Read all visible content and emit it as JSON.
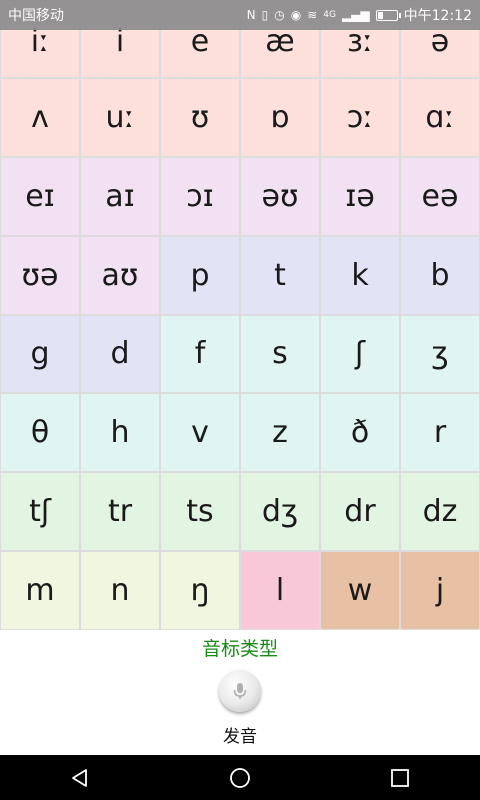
{
  "status_bar": {
    "carrier": "中国移动",
    "time": "中午12:12",
    "network": "4G",
    "battery_level": 0.3
  },
  "phonetic_grid": {
    "rows": [
      [
        {
          "symbol": "iː",
          "color": "#fde0dc"
        },
        {
          "symbol": "i",
          "color": "#fde0dc"
        },
        {
          "symbol": "e",
          "color": "#fde0dc"
        },
        {
          "symbol": "æ",
          "color": "#fde0dc"
        },
        {
          "symbol": "ɜː",
          "color": "#fde0dc"
        },
        {
          "symbol": "ə",
          "color": "#fde0dc"
        }
      ],
      [
        {
          "symbol": "ʌ",
          "color": "#fde0dc"
        },
        {
          "symbol": "uː",
          "color": "#fde0dc"
        },
        {
          "symbol": "ʊ",
          "color": "#fde0dc"
        },
        {
          "symbol": "ɒ",
          "color": "#fde0dc"
        },
        {
          "symbol": "ɔː",
          "color": "#fde0dc"
        },
        {
          "symbol": "ɑː",
          "color": "#fde0dc"
        }
      ],
      [
        {
          "symbol": "eɪ",
          "color": "#f2e0f3"
        },
        {
          "symbol": "aɪ",
          "color": "#f2e0f3"
        },
        {
          "symbol": "ɔɪ",
          "color": "#f2e0f3"
        },
        {
          "symbol": "əʊ",
          "color": "#f2e0f3"
        },
        {
          "symbol": "ɪə",
          "color": "#f2e0f3"
        },
        {
          "symbol": "eə",
          "color": "#f2e0f3"
        }
      ],
      [
        {
          "symbol": "ʊə",
          "color": "#f2e0f3"
        },
        {
          "symbol": "aʊ",
          "color": "#f2e0f3"
        },
        {
          "symbol": "p",
          "color": "#e2e4f6"
        },
        {
          "symbol": "t",
          "color": "#e2e4f6"
        },
        {
          "symbol": "k",
          "color": "#e2e4f6"
        },
        {
          "symbol": "b",
          "color": "#e2e4f6"
        }
      ],
      [
        {
          "symbol": "g",
          "color": "#e2e4f6"
        },
        {
          "symbol": "d",
          "color": "#e2e4f6"
        },
        {
          "symbol": "f",
          "color": "#e0f4f2"
        },
        {
          "symbol": "s",
          "color": "#e0f4f2"
        },
        {
          "symbol": "ʃ",
          "color": "#e0f4f2"
        },
        {
          "symbol": "ʒ",
          "color": "#e0f4f2"
        }
      ],
      [
        {
          "symbol": "θ",
          "color": "#e0f4f2"
        },
        {
          "symbol": "h",
          "color": "#e0f4f2"
        },
        {
          "symbol": "v",
          "color": "#e0f4f2"
        },
        {
          "symbol": "z",
          "color": "#e0f4f2"
        },
        {
          "symbol": "ð",
          "color": "#e0f4f2"
        },
        {
          "symbol": "r",
          "color": "#e0f4f2"
        }
      ],
      [
        {
          "symbol": "tʃ",
          "color": "#e2f4e2"
        },
        {
          "symbol": "tr",
          "color": "#e2f4e2"
        },
        {
          "symbol": "ts",
          "color": "#e2f4e2"
        },
        {
          "symbol": "dʒ",
          "color": "#e2f4e2"
        },
        {
          "symbol": "dr",
          "color": "#e2f4e2"
        },
        {
          "symbol": "dz",
          "color": "#e2f4e2"
        }
      ],
      [
        {
          "symbol": "m",
          "color": "#f1f6e0"
        },
        {
          "symbol": "n",
          "color": "#f1f6e0"
        },
        {
          "symbol": "ŋ",
          "color": "#f1f6e0"
        },
        {
          "symbol": "l",
          "color": "#f9c8d8"
        },
        {
          "symbol": "w",
          "color": "#e8c0a4"
        },
        {
          "symbol": "j",
          "color": "#e8c0a4"
        }
      ]
    ]
  },
  "controls": {
    "type_label": "音标类型",
    "speak_label": "发音",
    "type_label_color": "#1a8a1a"
  },
  "icons": {
    "mic": "microphone-icon",
    "nav_back": "back-triangle-icon",
    "nav_home": "home-circle-icon",
    "nav_recent": "recent-square-icon"
  }
}
